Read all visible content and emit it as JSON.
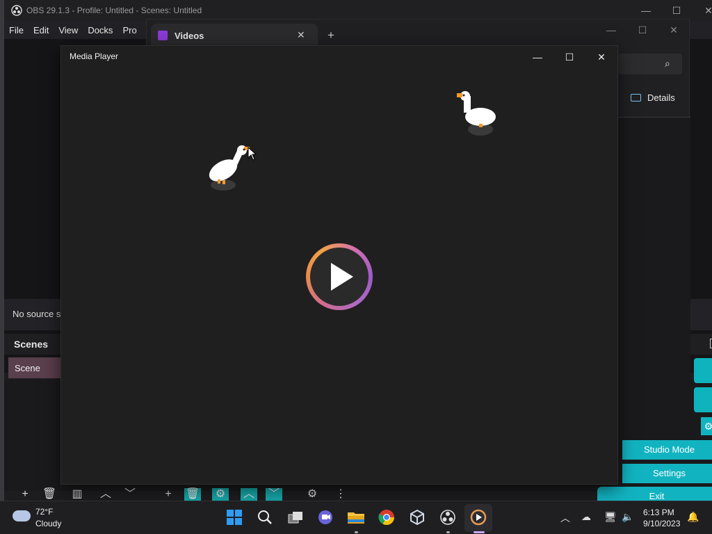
{
  "obs": {
    "title": "OBS 29.1.3 - Profile: Untitled - Scenes: Untitled",
    "menu": [
      "File",
      "Edit",
      "View",
      "Docks",
      "Pro"
    ],
    "no_source": "No source s",
    "scenes_header": "Scenes",
    "scene_item": "Scene",
    "controls": {
      "studio_mode": "Studio Mode",
      "settings": "Settings",
      "exit": "Exit"
    }
  },
  "videos_window": {
    "tab_label": "Videos",
    "details_label": "Details"
  },
  "media_player": {
    "title": "Media Player"
  },
  "taskbar": {
    "weather_temp": "72°F",
    "weather_desc": "Cloudy",
    "time": "6:13 PM",
    "date": "9/10/2023"
  },
  "colors": {
    "teal_accent": "#12b3c1",
    "scene_selected": "#5a3f4c",
    "play_ring_start": "#e88b4a",
    "play_ring_end": "#9b5cc8"
  }
}
